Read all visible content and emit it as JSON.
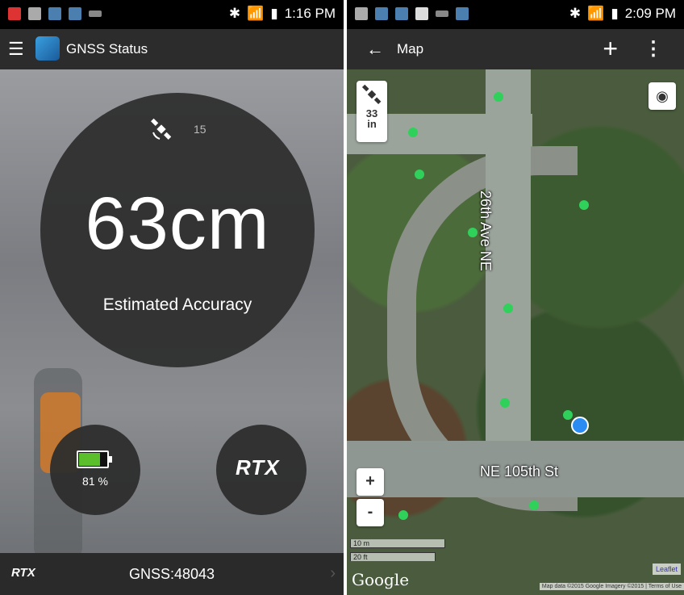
{
  "left": {
    "statusbar": {
      "time": "1:16 PM"
    },
    "appbar": {
      "title": "GNSS Status"
    },
    "satellites": "15",
    "accuracy": "63cm",
    "accuracy_label": "Estimated Accuracy",
    "battery": {
      "text": "81 %",
      "level": 0.81
    },
    "rtx_logo": "RTX",
    "bottombar": {
      "brand": "RTX",
      "gnss": "GNSS:48043"
    }
  },
  "right": {
    "statusbar": {
      "time": "2:09 PM"
    },
    "appbar": {
      "title": "Map"
    },
    "sat_badge": {
      "value": "33",
      "unit": "in"
    },
    "roads": {
      "vertical": "26th Ave NE",
      "horizontal": "NE 105th St"
    },
    "zoom_in": "+",
    "zoom_out": "-",
    "scale": {
      "m": "10 m",
      "ft": "20 ft"
    },
    "google": "Google",
    "leaflet": "Leaflet",
    "attribution": "Map data ©2015 Google Imagery ©2015 | Terms of Use"
  },
  "colors": {
    "accent_green": "#5bbf2b",
    "points": "#2fd15a",
    "location": "#2a8bf2"
  }
}
